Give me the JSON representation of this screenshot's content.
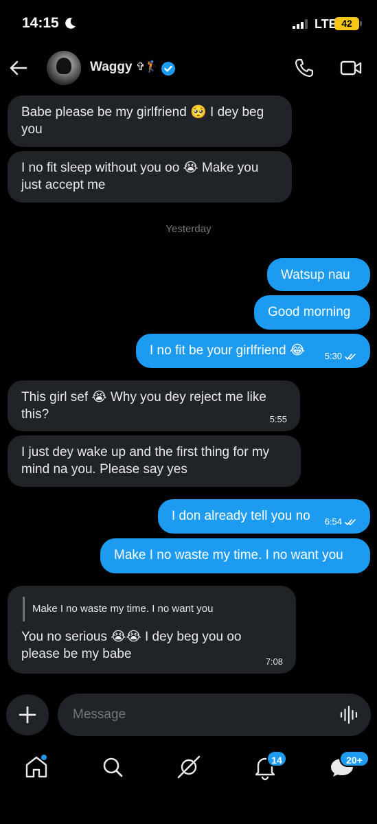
{
  "status_bar": {
    "time": "14:15",
    "network": "LTE",
    "battery": "42",
    "icons": [
      "moon-icon",
      "signal-icon"
    ]
  },
  "header": {
    "contact_name": "Waggy",
    "name_decoration": "✞🏌",
    "icons": [
      "back-arrow-icon",
      "verified-badge-icon",
      "phone-icon",
      "video-icon"
    ]
  },
  "messages": [
    {
      "direction": "in",
      "text": "Babe please be my girlfriend 🥺 I dey beg you"
    },
    {
      "direction": "in",
      "text": "I no fit sleep without you oo 😭 Make you just accept me"
    },
    {
      "type": "divider",
      "text": "Yesterday"
    },
    {
      "direction": "out",
      "text": "Watsup nau"
    },
    {
      "direction": "out",
      "text": "Good morning"
    },
    {
      "direction": "out",
      "text": "I no fit be your girlfriend 😂",
      "time": "5:30",
      "read": true
    },
    {
      "direction": "in",
      "text": "This girl sef 😭 Why you dey reject me like this?",
      "time": "5:55"
    },
    {
      "direction": "in",
      "text": "I just dey wake up and the first thing for my mind na you. Please say yes"
    },
    {
      "direction": "out",
      "text": "I don already tell you no",
      "time": "6:54",
      "read": true
    },
    {
      "direction": "out",
      "text": "Make I no waste my time. I no want you"
    },
    {
      "direction": "in",
      "quote": "Make I no waste my time. I no want you",
      "text": "You no serious 😭😭 I dey beg you oo please be my babe",
      "time": "7:08"
    }
  ],
  "composer": {
    "placeholder": "Message",
    "icons": [
      "plus-icon",
      "voice-wave-icon"
    ]
  },
  "tabbar": {
    "items": [
      "home-icon",
      "search-icon",
      "grok-icon",
      "notifications-icon",
      "messages-icon"
    ],
    "notifications_badge": "14",
    "messages_badge": "20+"
  },
  "colors": {
    "background": "#000000",
    "incoming_bubble": "#202327",
    "outgoing_bubble": "#1d9bf0",
    "muted_text": "#71767b",
    "battery": "#f5c518"
  }
}
